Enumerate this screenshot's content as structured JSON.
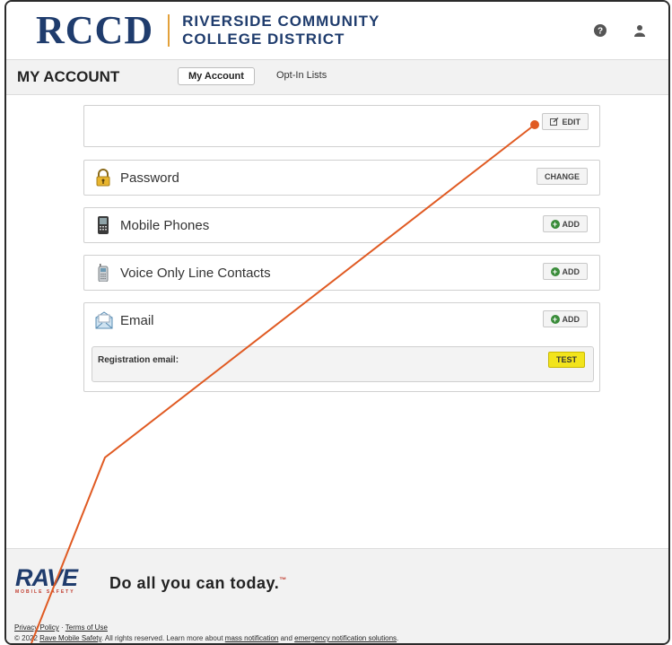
{
  "header": {
    "logo_short": "RCCD",
    "logo_line1": "RIVERSIDE COMMUNITY",
    "logo_line2": "COLLEGE DISTRICT",
    "help_icon": "question-circle-icon",
    "user_icon": "user-icon"
  },
  "nav": {
    "title": "MY ACCOUNT",
    "tabs": [
      {
        "label": "My Account",
        "active": true
      },
      {
        "label": "Opt-In Lists",
        "active": false
      }
    ]
  },
  "profile_card": {
    "edit_label": "EDIT"
  },
  "cards": [
    {
      "label": "Password",
      "button": "CHANGE",
      "icon": "lock-icon"
    },
    {
      "label": "Mobile Phones",
      "button": "ADD",
      "icon": "mobile-phone-icon"
    },
    {
      "label": "Voice Only Line Contacts",
      "button": "ADD",
      "icon": "cordless-phone-icon"
    },
    {
      "label": "Email",
      "button": "ADD",
      "icon": "envelope-icon"
    }
  ],
  "email": {
    "registration_label": "Registration email:",
    "test_label": "TEST"
  },
  "footer": {
    "brand": "RAVE",
    "brand_sub": "MOBILE SAFETY",
    "tagline": "Do all you can today.",
    "tagline_mark": "™",
    "privacy": "Privacy Policy",
    "separator": "·",
    "terms": "Terms of Use",
    "copy_prefix": "© 2022 ",
    "copy_company": "Rave Mobile Safety",
    "copy_mid": ". All rights reserved. Learn more about ",
    "copy_link1": "mass notification",
    "copy_and": " and ",
    "copy_link2": "emergency notification solutions",
    "copy_end": "."
  },
  "colors": {
    "brand_navy": "#1f3c6d",
    "brand_gold": "#e3a13b",
    "annotation": "#e05a22",
    "test_yellow": "#f2e41c",
    "add_green": "#3a8c3a"
  }
}
